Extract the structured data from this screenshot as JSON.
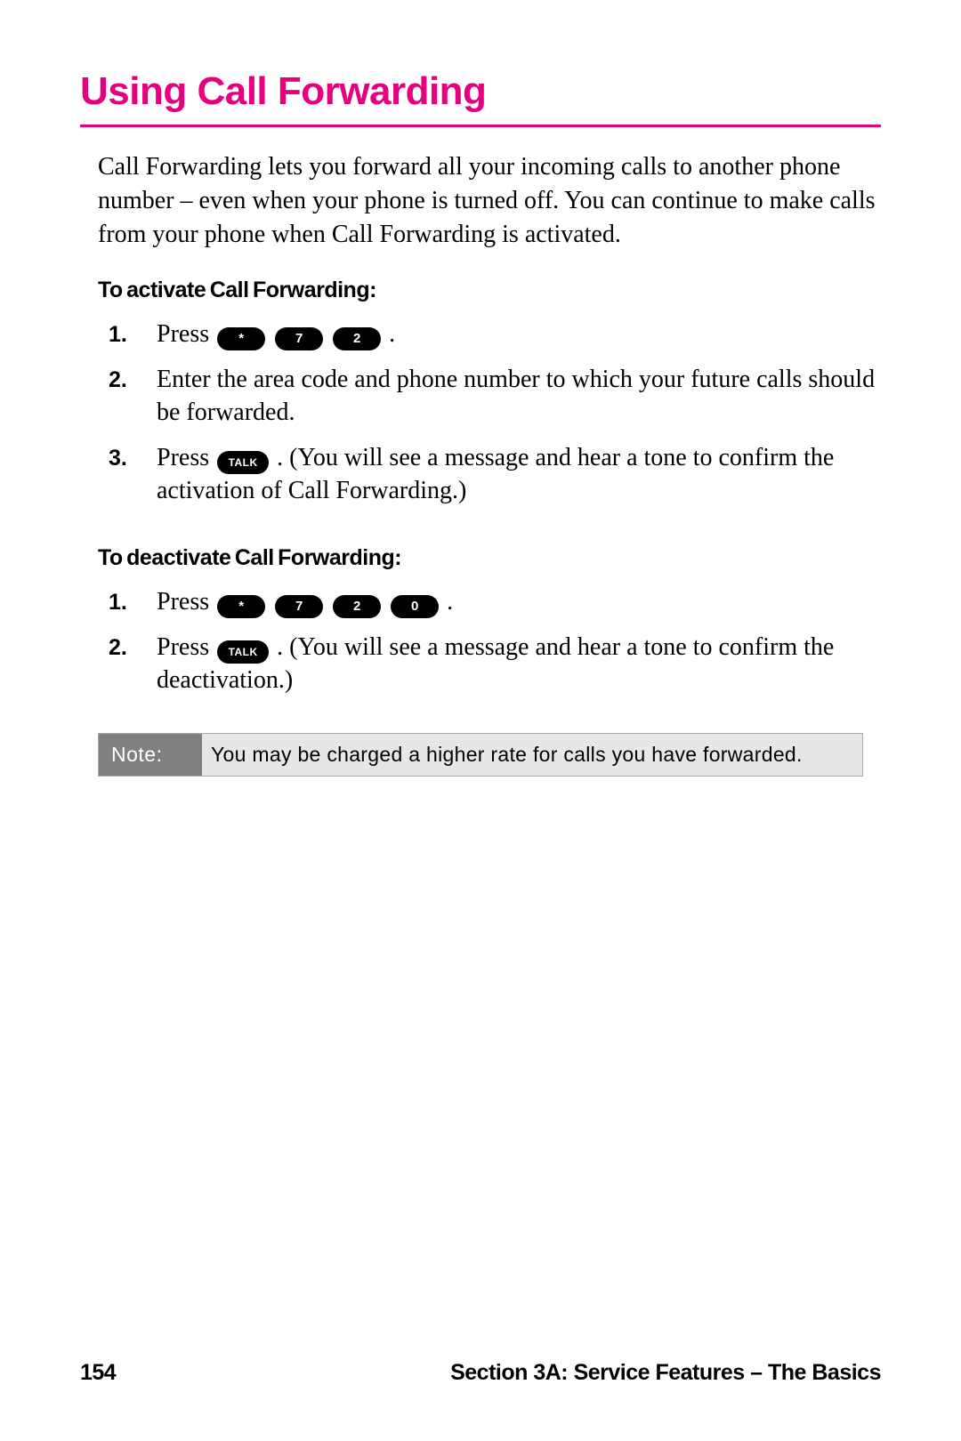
{
  "title": "Using Call Forwarding",
  "intro": "Call Forwarding lets you forward all your incoming calls to another phone number – even when your phone is turned off. You can continue to make calls from your phone when Call Forwarding is activated.",
  "activate": {
    "heading": "To activate Call Forwarding:",
    "steps": {
      "s1": {
        "num": "1.",
        "pre": "Press ",
        "keys": [
          "*",
          "7",
          "2"
        ],
        "post": "."
      },
      "s2": {
        "num": "2.",
        "text": "Enter the area code and phone number to which your future calls should be forwarded."
      },
      "s3": {
        "num": "3.",
        "pre": "Press ",
        "keys": [
          "TALK"
        ],
        "post": ". (You will see a message and hear a tone to confirm the activation of Call Forwarding.)"
      }
    }
  },
  "deactivate": {
    "heading": "To deactivate Call Forwarding:",
    "steps": {
      "s1": {
        "num": "1.",
        "pre": "Press ",
        "keys": [
          "*",
          "7",
          "2",
          "0"
        ],
        "post": "."
      },
      "s2": {
        "num": "2.",
        "pre": "Press ",
        "keys": [
          "TALK"
        ],
        "post": ". (You will see a message and hear a tone to confirm the deactivation.)"
      }
    }
  },
  "note": {
    "label": "Note:",
    "text": "You may be charged a higher rate for calls you have forwarded."
  },
  "footer": {
    "page": "154",
    "section": "Section 3A: Service Features – The Basics"
  }
}
